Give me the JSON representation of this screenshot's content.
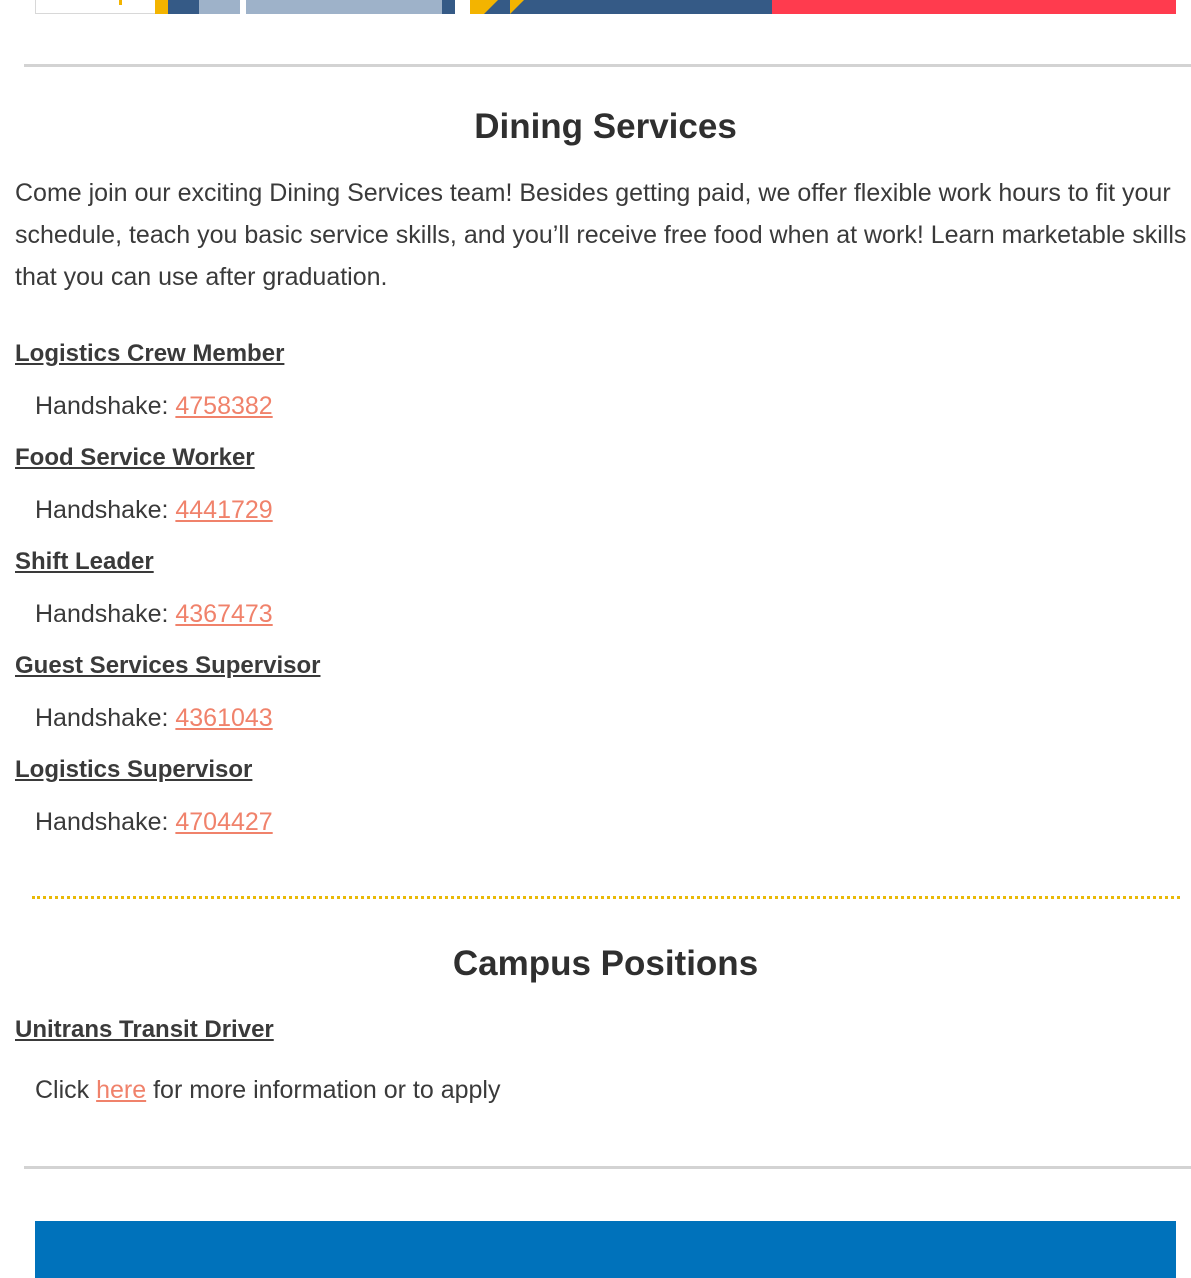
{
  "dining": {
    "heading": "Dining Services",
    "intro": "Come join our exciting Dining Services team!  Besides getting paid, we offer flexible work hours to fit your schedule, teach you basic service skills, and you’ll receive free food when at work! Learn marketable skills that you can use after graduation.",
    "handshake_label": "Handshake: ",
    "jobs": [
      {
        "title": "Logistics Crew Member",
        "id": "4758382"
      },
      {
        "title": "Food Service Worker",
        "id": "4441729"
      },
      {
        "title": "Shift Leader",
        "id": "4367473"
      },
      {
        "title": "Guest Services Supervisor",
        "id": "4361043"
      },
      {
        "title": "Logistics Supervisor",
        "id": "4704427"
      }
    ]
  },
  "campus": {
    "heading": "Campus Positions",
    "job_title": "Unitrans Transit Driver",
    "click_prefix": "Click ",
    "link_text": "here",
    "click_suffix": " for more information or to apply"
  },
  "colors": {
    "link": "#f0826b",
    "navy": "#355a86",
    "gold": "#f3b400",
    "red": "#ff3b4e",
    "footer_blue": "#0072bb"
  }
}
